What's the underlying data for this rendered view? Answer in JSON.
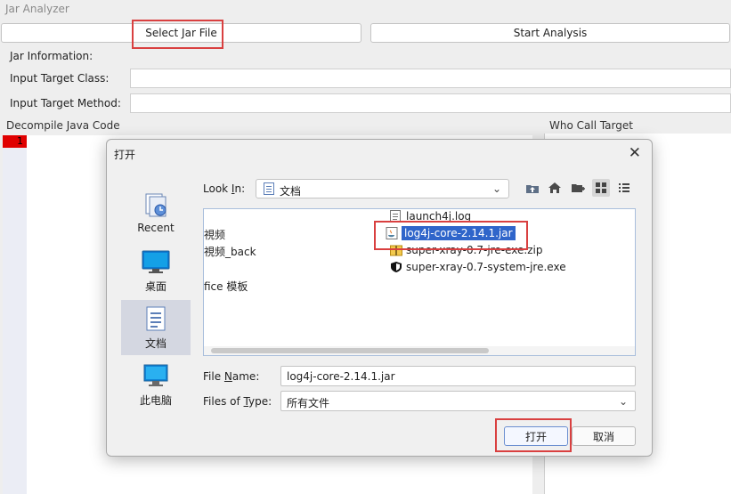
{
  "app": {
    "title": "Jar Analyzer",
    "select_jar_label": "Select Jar File",
    "start_analysis_label": "Start Analysis",
    "jar_info_label": "Jar Information:",
    "target_class_label": "Input Target Class:",
    "target_method_label": "Input Target Method:",
    "decompile_title": "Decompile Java Code",
    "who_call_title": "Who Call Target",
    "line_number": "1"
  },
  "dialog": {
    "title": "打开",
    "close_glyph": "✕",
    "look_in_label_pre": "Look ",
    "look_in_label_u": "I",
    "look_in_label_post": "n:",
    "look_in_value": "文档",
    "places": [
      {
        "label": "Recent",
        "icon": "recent-icon"
      },
      {
        "label": "桌面",
        "icon": "desktop-icon"
      },
      {
        "label": "文档",
        "icon": "documents-icon"
      },
      {
        "label": "此电脑",
        "icon": "computer-icon"
      }
    ],
    "files_left": [
      "視频",
      "視频_back",
      "",
      "fice 模板"
    ],
    "files_right": [
      {
        "name": "launch4j.log",
        "icon": "text-file-icon"
      },
      {
        "name": "log4j-core-2.14.1.jar",
        "icon": "jar-file-icon",
        "selected": true
      },
      {
        "name": "super-xray-0.7-jre-exe.zip",
        "icon": "zip-file-icon"
      },
      {
        "name": "super-xray-0.7-system-jre.exe",
        "icon": "shield-exe-icon"
      }
    ],
    "file_name_label_pre": "File ",
    "file_name_label_u": "N",
    "file_name_label_post": "ame:",
    "file_name_value": "log4j-core-2.14.1.jar",
    "file_type_label_pre": "Files of ",
    "file_type_label_u": "T",
    "file_type_label_post": "ype:",
    "file_type_value": "所有文件",
    "open_label": "打开",
    "cancel_label": "取消"
  },
  "colors": {
    "highlight": "#d94040",
    "selection": "#2f65ca",
    "line_marker": "#e00000"
  }
}
